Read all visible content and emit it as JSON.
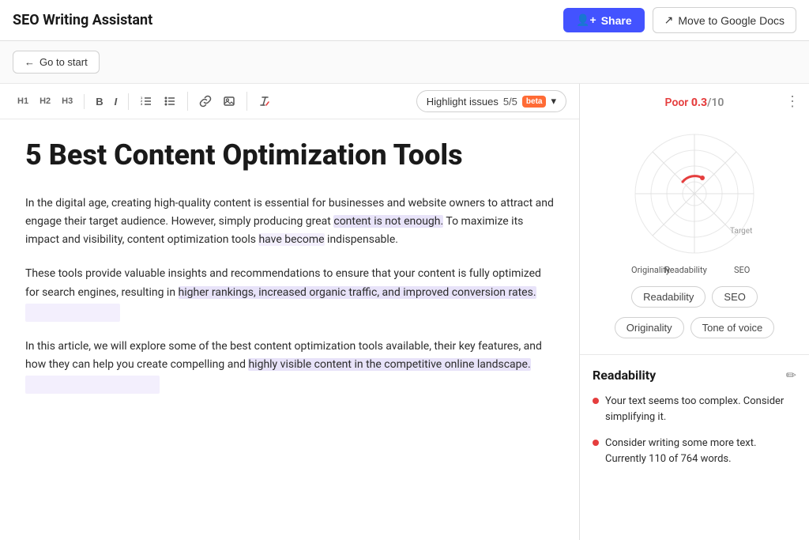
{
  "header": {
    "title": "SEO Writing Assistant",
    "share_label": "Share",
    "move_docs_label": "Move to Google Docs",
    "share_icon": "👤+",
    "move_icon": "→"
  },
  "nav": {
    "go_start_label": "Go to start",
    "arrow": "←"
  },
  "toolbar": {
    "h1": "H1",
    "h2": "H2",
    "h3": "H3",
    "bold": "B",
    "italic": "I",
    "highlight_label": "Highlight issues",
    "highlight_count": "5/5",
    "beta_label": "beta",
    "chevron": "▾"
  },
  "editor": {
    "title": "5 Best Content Optimization Tools",
    "paragraphs": [
      "In the digital age, creating high-quality content is essential for businesses and website owners to attract and engage their target audience. However, simply producing great content is not enough. To maximize its impact and visibility, content optimization tools have become indispensable.",
      "These tools provide valuable insights and recommendations to ensure that your content is fully optimized for search engines, resulting in higher rankings, increased organic traffic, and improved conversion rates.",
      "In this article, we will explore some of the best content optimization tools available, their key features, and how they can help you create compelling and highly visible content in the competitive online landscape."
    ]
  },
  "score_panel": {
    "label_poor": "Poor",
    "score_value": "0.3",
    "score_out_of": "/10",
    "menu_icon": "⋮",
    "readability_pill": "Readability",
    "seo_pill": "SEO",
    "originality_pill": "Originality",
    "tone_of_voice_pill": "Tone of voice",
    "target_label": "Target"
  },
  "readability": {
    "title": "Readability",
    "edit_icon": "✏",
    "items": [
      "Your text seems too complex. Consider simplifying it.",
      "Consider writing some more text. Currently 110 of 764 words."
    ]
  }
}
